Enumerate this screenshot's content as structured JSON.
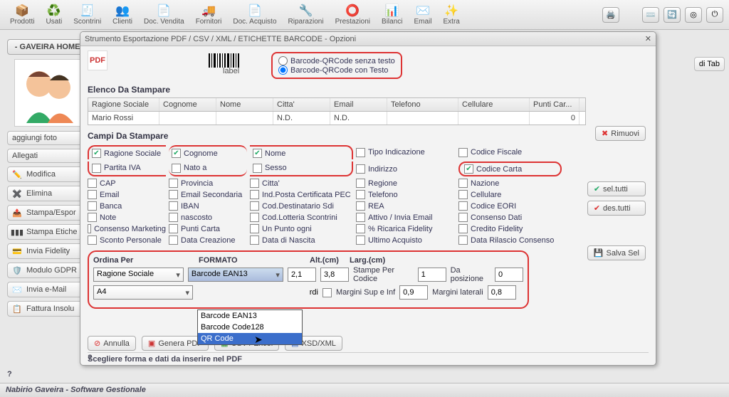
{
  "main_toolbar": [
    {
      "id": "prodotti",
      "label": "Prodotti",
      "icon": "📦"
    },
    {
      "id": "usati",
      "label": "Usati",
      "icon": "♻️"
    },
    {
      "id": "scontrini",
      "label": "Scontrini",
      "icon": "🧾"
    },
    {
      "id": "clienti",
      "label": "Clienti",
      "icon": "👥"
    },
    {
      "id": "docvendita",
      "label": "Doc. Vendita",
      "icon": "📄"
    },
    {
      "id": "fornitori",
      "label": "Fornitori",
      "icon": "🚚"
    },
    {
      "id": "docacquisto",
      "label": "Doc. Acquisto",
      "icon": "📄"
    },
    {
      "id": "riparazioni",
      "label": "Riparazioni",
      "icon": "🔧"
    },
    {
      "id": "prestazioni",
      "label": "Prestazioni",
      "icon": "⭕"
    },
    {
      "id": "bilanci",
      "label": "Bilanci",
      "icon": "📊"
    },
    {
      "id": "email",
      "label": "Email",
      "icon": "✉️"
    },
    {
      "id": "extra",
      "label": "Extra",
      "icon": "✨"
    }
  ],
  "home_button": "- GAVEIRA HOME -",
  "side_buttons": {
    "aggiungi_foto": "aggiungi foto",
    "allegati": "Allegati",
    "modifica": "Modifica",
    "elimina": "Elimina",
    "stampa_esporta": "Stampa/Espor",
    "stampa_etich": "Stampa Etiche",
    "invia_fidelity": "Invia Fidelity",
    "modulo_gdpr": "Modulo GDPR",
    "invia_email": "Invia e-Mail",
    "fattura_insolu": "Fattura Insolu"
  },
  "dialog": {
    "title": "Strumento Esportazione PDF / CSV / XML / ETICHETTE BARCODE - Opzioni",
    "radio": {
      "without": "Barcode-QRCode senza testo",
      "with": "Barcode-QRCode con Testo"
    },
    "elenco_title": "Elenco Da Stampare",
    "columns": {
      "ragione": "Ragione Sociale",
      "cognome": "Cognome",
      "nome": "Nome",
      "citta": "Citta'",
      "email": "Email",
      "telefono": "Telefono",
      "cellulare": "Cellulare",
      "punti": "Punti Car..."
    },
    "row": {
      "ragione": "Mario Rossi",
      "cognome": "",
      "nome": "",
      "citta": "N.D.",
      "email": "N.D.",
      "telefono": "",
      "cellulare": "",
      "punti": "0"
    },
    "rimuovi": "Rimuovi",
    "campi_title": "Campi Da Stampare",
    "checks": {
      "ragione": "Ragione Sociale",
      "cognome": "Cognome",
      "nome": "Nome",
      "tipo": "Tipo Indicazione",
      "cfisc": "Codice Fiscale",
      "piva": "Partita IVA",
      "nato": "Nato a",
      "sesso": "Sesso",
      "indir": "Indirizzo",
      "ccarta": "Codice Carta",
      "cap": "CAP",
      "prov": "Provincia",
      "citta": "Citta'",
      "regione": "Regione",
      "nazione": "Nazione",
      "email": "Email",
      "email2": "Email Secondaria",
      "pec": "Ind.Posta Certificata PEC",
      "tel": "Telefono",
      "cel": "Cellulare",
      "banca": "Banca",
      "iban": "IBAN",
      "sdi": "Cod.Destinatario Sdi",
      "rea": "REA",
      "eori": "Codice EORI",
      "note": "Note",
      "nascosto": "nascosto",
      "lotteria": "Cod.Lotteria Scontrini",
      "attivo": "Attivo / Invia Email",
      "consenso": "Consenso Dati",
      "marketing": "Consenso Marketing",
      "pcarta": "Punti Carta",
      "unpunto": "Un Punto ogni",
      "ricarica": "% Ricarica Fidelity",
      "credito": "Credito Fidelity",
      "spers": "Sconto Personale",
      "dcrea": "Data Creazione",
      "dnasc": "Data di Nascita",
      "uacq": "Ultimo Acquisto",
      "drilcons": "Data Rilascio Consenso"
    },
    "right_actions": {
      "seltutti": "sel.tutti",
      "destutti": "des.tutti",
      "salvasel": "Salva Sel"
    },
    "ordina": {
      "label_ordina": "Ordina Per",
      "label_formato": "FORMATO",
      "label_alt": "Alt.(cm)",
      "label_larg": "Larg.(cm)",
      "sel_ordina": "Ragione Sociale",
      "sel_formato": "Barcode EAN13",
      "alt": "2,1",
      "larg": "3,8",
      "stampe_label": "Stampe Per Codice",
      "stampe": "1",
      "dapos_label": "Da posizione",
      "dapos": "0",
      "sel_pagina": "A4",
      "margini_sup_label": "Margini Sup e Inf",
      "margini_sup": "0,9",
      "margini_lat_label": "Margini laterali",
      "margini_lat": "0,8",
      "dropdown": [
        "Barcode EAN13",
        "Barcode Code128",
        "QR Code"
      ]
    },
    "bottom_buttons": {
      "annulla": "Annulla",
      "genera": "Genera PDF",
      "csv": "CSV / Excel",
      "xsd": "XSD/XML"
    },
    "footer": "Scegliere forma e dati da inserire nel PDF"
  },
  "tab_label": "di Tab",
  "status": "Nabirio Gaveira - Software Gestionale"
}
